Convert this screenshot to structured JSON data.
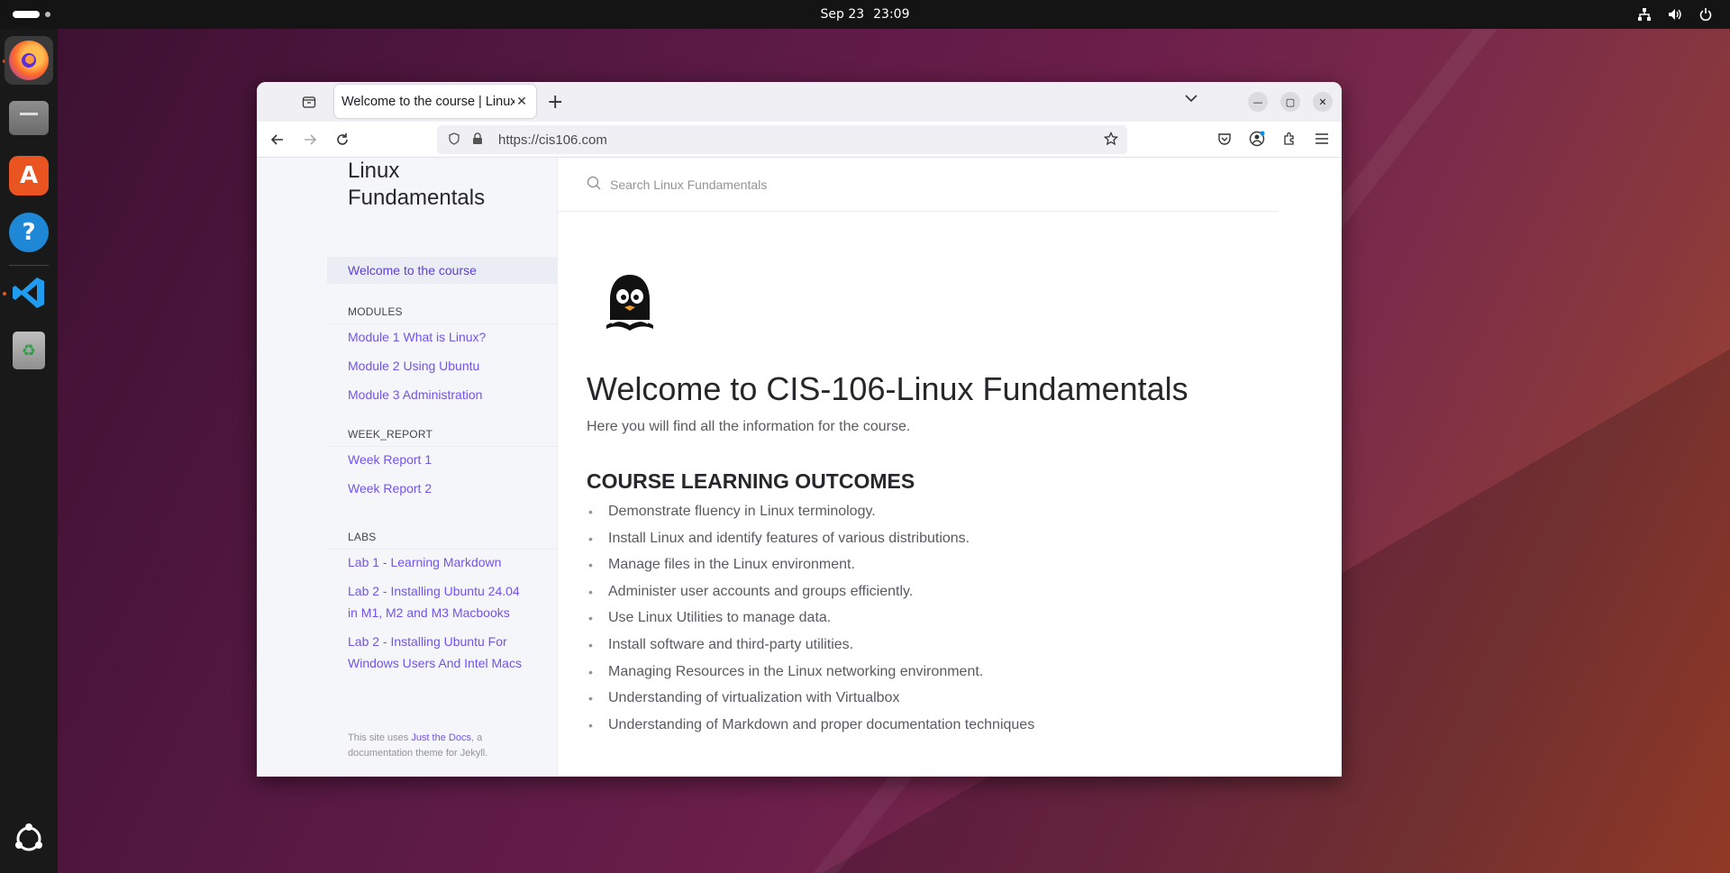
{
  "topbar": {
    "date": "Sep 23",
    "time": "23:09"
  },
  "dock": {
    "apps": [
      "firefox-icon",
      "files-icon",
      "app-center-icon",
      "help-icon",
      "vscode-icon",
      "trash-icon"
    ],
    "show_apps": "show-apps-icon"
  },
  "browser": {
    "tab_title": "Welcome to the course | Linux Fundamentals",
    "url": "https://cis106.com"
  },
  "site": {
    "title": "Linux Fundamentals",
    "search_placeholder": "Search Linux Fundamentals",
    "nav": {
      "active": "Welcome to the course",
      "modules_heading": "MODULES",
      "modules": [
        "Module 1 What is Linux?",
        "Module 2 Using Ubuntu",
        "Module 3 Administration"
      ],
      "week_heading": "WEEK_REPORT",
      "weeks": [
        "Week Report 1",
        "Week Report 2"
      ],
      "labs_heading": "LABS",
      "labs": [
        "Lab 1 - Learning Markdown",
        "Lab 2 - Installing Ubuntu 24.04 in M1, M2 and M3 Macbooks",
        "Lab 2 - Installing Ubuntu For Windows Users And Intel Macs"
      ]
    },
    "footer": {
      "prefix": "This site uses ",
      "link": "Just the Docs",
      "suffix": ", a documentation theme for Jekyll."
    }
  },
  "content": {
    "title": "Welcome to CIS-106-Linux Fundamentals",
    "intro": "Here you will find all the information for the course.",
    "outcomes_heading": "COURSE LEARNING OUTCOMES",
    "outcomes": [
      "Demonstrate fluency in Linux terminology.",
      "Install Linux and identify features of various distributions.",
      "Manage files in the Linux environment.",
      "Administer user accounts and groups efficiently.",
      "Use Linux Utilities to manage data.",
      "Install software and third-party utilities.",
      "Managing Resources in the Linux networking environment.",
      "Understanding of virtualization with Virtualbox",
      "Understanding of Markdown and proper documentation techniques"
    ]
  }
}
